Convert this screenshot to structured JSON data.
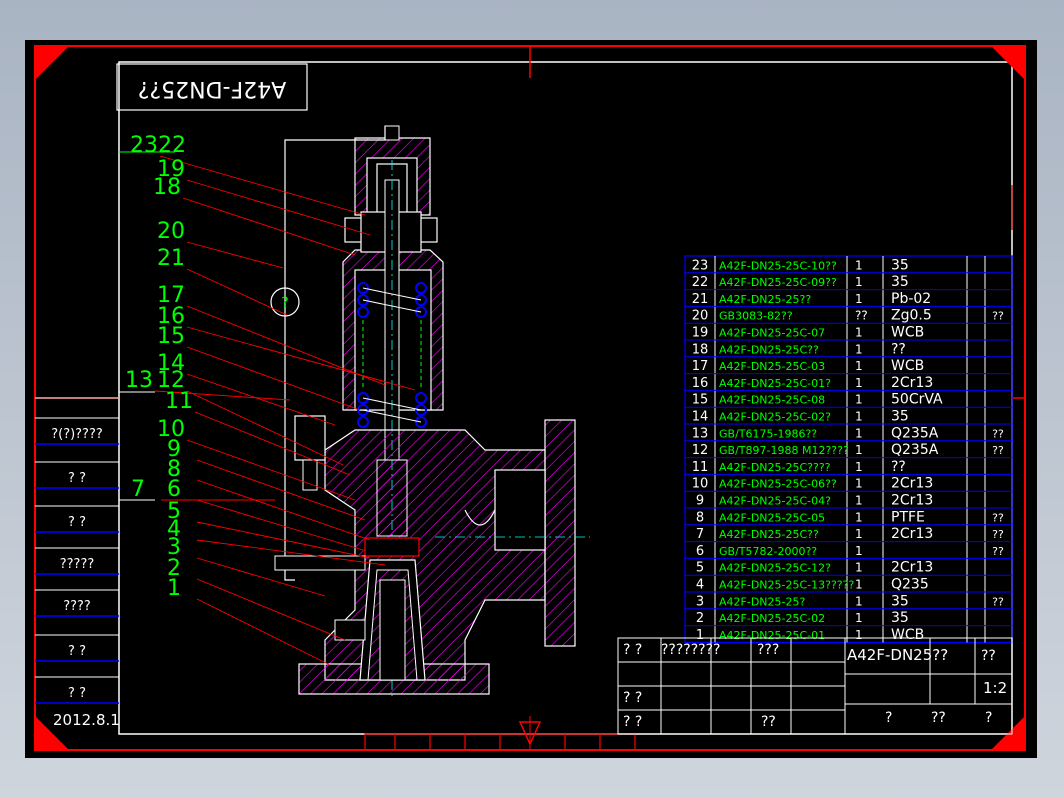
{
  "title_block_text": "A42F-DN25??",
  "leader_labels": [
    "2322",
    "19",
    "18",
    "20",
    "21",
    "17",
    "16",
    "15",
    "14",
    "12",
    "13",
    "11",
    "10",
    "9",
    "8",
    "6",
    "7",
    "5",
    "4",
    "3",
    "2",
    "1"
  ],
  "side_stamps": [
    "?(?)????",
    "?   ?",
    "?   ?",
    "?????",
    "????",
    "?   ?",
    "?   ?"
  ],
  "date": "2012.8.1",
  "parts_table": [
    {
      "no": "23",
      "code": "A42F-DN25-25C-10??",
      "qty": "1",
      "mat": "35",
      "note": ""
    },
    {
      "no": "22",
      "code": "A42F-DN25-25C-09??",
      "qty": "1",
      "mat": "35",
      "note": ""
    },
    {
      "no": "21",
      "code": "A42F-DN25-25??",
      "qty": "1",
      "mat": "Pb-02",
      "note": ""
    },
    {
      "no": "20",
      "code": "GB3083-82??",
      "qty": "??",
      "mat": "Zg0.5",
      "note": "??"
    },
    {
      "no": "19",
      "code": "A42F-DN25-25C-07",
      "qty": "1",
      "mat": "WCB",
      "note": ""
    },
    {
      "no": "18",
      "code": "A42F-DN25-25C??",
      "qty": "1",
      "mat": "??",
      "note": ""
    },
    {
      "no": "17",
      "code": "A42F-DN25-25C-03",
      "qty": "1",
      "mat": "WCB",
      "note": ""
    },
    {
      "no": "16",
      "code": "A42F-DN25-25C-01?",
      "qty": "1",
      "mat": "2Cr13",
      "note": ""
    },
    {
      "no": "15",
      "code": "A42F-DN25-25C-08",
      "qty": "1",
      "mat": "50CrVA",
      "note": ""
    },
    {
      "no": "14",
      "code": "A42F-DN25-25C-02?",
      "qty": "1",
      "mat": "35",
      "note": ""
    },
    {
      "no": "13",
      "code": "GB/T6175-1986??",
      "qty": "1",
      "mat": "Q235A",
      "note": "??"
    },
    {
      "no": "12",
      "code": "GB/T897-1988 M12????",
      "qty": "1",
      "mat": "Q235A",
      "note": "??"
    },
    {
      "no": "11",
      "code": "A42F-DN25-25C????",
      "qty": "1",
      "mat": "??",
      "note": ""
    },
    {
      "no": "10",
      "code": "A42F-DN25-25C-06??",
      "qty": "1",
      "mat": "2Cr13",
      "note": ""
    },
    {
      "no": "9",
      "code": "A42F-DN25-25C-04?",
      "qty": "1",
      "mat": "2Cr13",
      "note": ""
    },
    {
      "no": "8",
      "code": "A42F-DN25-25C-05",
      "qty": "1",
      "mat": "PTFE",
      "note": "??"
    },
    {
      "no": "7",
      "code": "A42F-DN25-25C??",
      "qty": "1",
      "mat": "2Cr13",
      "note": "??"
    },
    {
      "no": "6",
      "code": "GB/T5782-2000??",
      "qty": "1",
      "mat": "",
      "note": "??"
    },
    {
      "no": "5",
      "code": "A42F-DN25-25C-12?",
      "qty": "1",
      "mat": "2Cr13",
      "note": ""
    },
    {
      "no": "4",
      "code": "A42F-DN25-25C-13?????",
      "qty": "1",
      "mat": "Q235",
      "note": ""
    },
    {
      "no": "3",
      "code": "A42F-DN25-25?",
      "qty": "1",
      "mat": "35",
      "note": "??"
    },
    {
      "no": "2",
      "code": "A42F-DN25-25C-02",
      "qty": "1",
      "mat": "35",
      "note": ""
    },
    {
      "no": "1",
      "code": "A42F-DN25-25C-01",
      "qty": "1",
      "mat": "WCB",
      "note": ""
    }
  ],
  "title_block": {
    "c1": "? ?",
    "c2": "????????",
    "c3": "???",
    "name": "A42F-DN25??",
    "name_q": "??",
    "scale": "1:2",
    "r2a": "? ?",
    "r3a": "? ?",
    "r3b": "??",
    "f1": "?",
    "f2": "??",
    "f3": "?"
  },
  "colors": {
    "frame": "#ff0000",
    "text_green": "#00ff00",
    "text_white": "#ffffff",
    "hatch": "#ff00ff",
    "leader": "#ff0000",
    "table_line": "#0000ff",
    "spring": "#0000ff"
  }
}
